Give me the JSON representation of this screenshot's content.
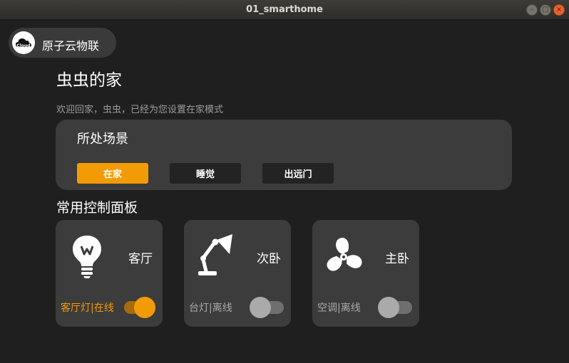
{
  "window": {
    "title": "01_smarthome",
    "minimize_glyph": "–",
    "maximize_glyph": "□",
    "close_glyph": "×"
  },
  "brand": {
    "logo_text": "Cloud",
    "name": "原子云物联"
  },
  "header": {
    "title": "虫虫的家",
    "welcome": "欢迎回家，虫虫，已经为您设置在家模式"
  },
  "scenes": {
    "title": "所处场景",
    "buttons": [
      {
        "label": "在家",
        "active": true
      },
      {
        "label": "睡觉",
        "active": false
      },
      {
        "label": "出远门",
        "active": false
      }
    ]
  },
  "control_panel": {
    "title": "常用控制面板",
    "devices": [
      {
        "room": "客厅",
        "status": "客厅灯|在线",
        "icon": "lightbulb-icon",
        "on": true
      },
      {
        "room": "次卧",
        "status": "台灯|离线",
        "icon": "desk-lamp-icon",
        "on": false
      },
      {
        "room": "主卧",
        "status": "空调|离线",
        "icon": "fan-icon",
        "on": false
      }
    ]
  },
  "colors": {
    "accent": "#f29b07",
    "card": "#3c3c3c",
    "background": "#1f1f1f"
  }
}
